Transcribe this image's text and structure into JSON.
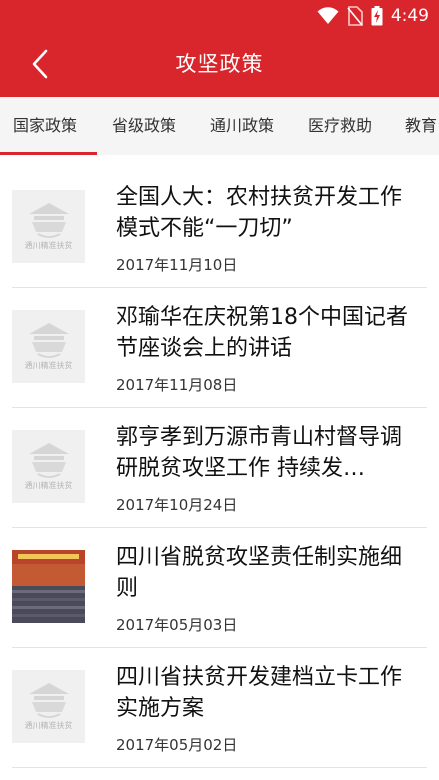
{
  "status_bar": {
    "time": "4:49",
    "icons": [
      "wifi-icon",
      "no-sim-icon",
      "battery-charging-icon"
    ]
  },
  "header": {
    "title": "攻坚政策",
    "back_icon": "back-arrow-icon"
  },
  "colors": {
    "primary": "#d9262c",
    "tab_bg": "#f5f5f5",
    "divider": "#e3e3e3"
  },
  "tabs": [
    {
      "label": "国家政策",
      "active": true
    },
    {
      "label": "省级政策",
      "active": false
    },
    {
      "label": "通川政策",
      "active": false
    },
    {
      "label": "医疗救助",
      "active": false
    },
    {
      "label": "教育",
      "active": false
    }
  ],
  "articles": [
    {
      "title": "全国人大：农村扶贫开发工作模式不能“一刀切”",
      "date": "2017年11月10日",
      "thumb": "placeholder",
      "thumb_label": "通川精准扶贫"
    },
    {
      "title": "邓瑜华在庆祝第18个中国记者节座谈会上的讲话",
      "date": "2017年11月08日",
      "thumb": "placeholder",
      "thumb_label": "通川精准扶贫"
    },
    {
      "title": "郭亨孝到万源市青山村督导调研脱贫攻坚工作 持续发…",
      "date": "2017年10月24日",
      "thumb": "placeholder",
      "thumb_label": "通川精准扶贫"
    },
    {
      "title": "四川省脱贫攻坚责任制实施细则",
      "date": "2017年05月03日",
      "thumb": "photo",
      "thumb_label": ""
    },
    {
      "title": "四川省扶贫开发建档立卡工作实施方案",
      "date": "2017年05月02日",
      "thumb": "placeholder",
      "thumb_label": "通川精准扶贫"
    }
  ]
}
